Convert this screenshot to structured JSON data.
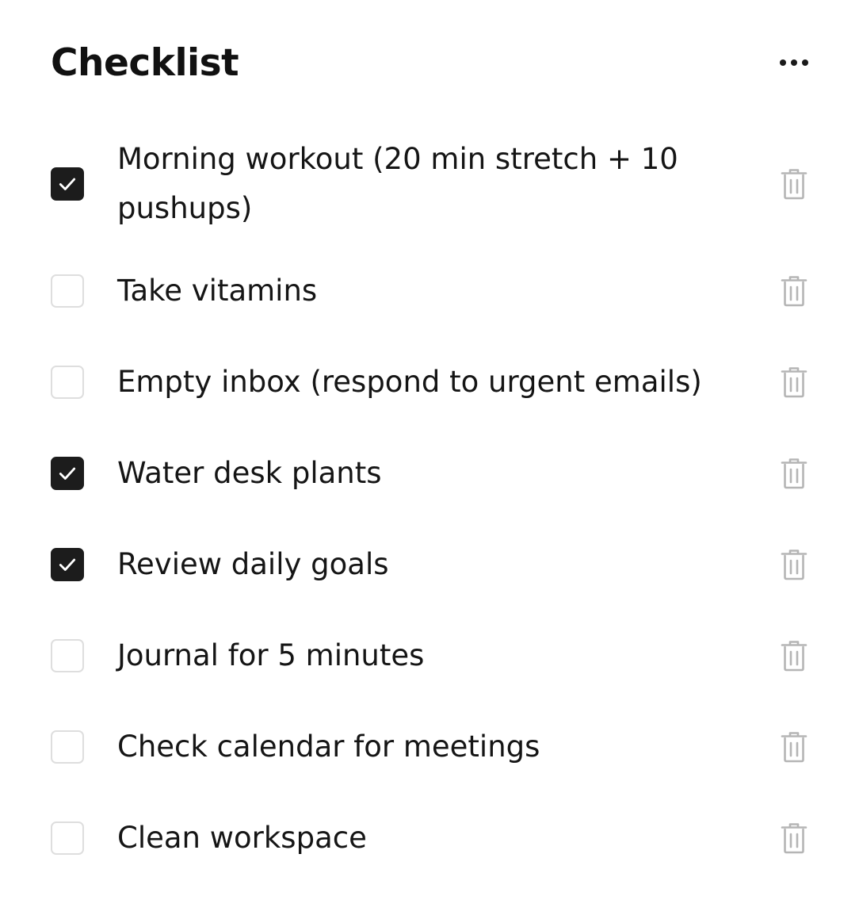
{
  "header": {
    "title": "Checklist",
    "more_icon": "more-horizontal-icon"
  },
  "items": [
    {
      "label": "Morning workout (20 min stretch + 10 pushups)",
      "checked": true
    },
    {
      "label": "Take vitamins",
      "checked": false
    },
    {
      "label": "Empty inbox (respond to urgent emails)",
      "checked": false
    },
    {
      "label": "Water desk plants",
      "checked": true
    },
    {
      "label": "Review daily goals",
      "checked": true
    },
    {
      "label": "Journal for 5 minutes",
      "checked": false
    },
    {
      "label": "Check calendar for meetings",
      "checked": false
    },
    {
      "label": "Clean workspace",
      "checked": false
    }
  ],
  "icons": {
    "check": "check-icon",
    "delete": "trash-icon"
  },
  "colors": {
    "checked_fill": "#1c1c1c",
    "unchecked_border": "#dedede",
    "trash_icon": "#b5b5b5",
    "text": "#151515"
  }
}
